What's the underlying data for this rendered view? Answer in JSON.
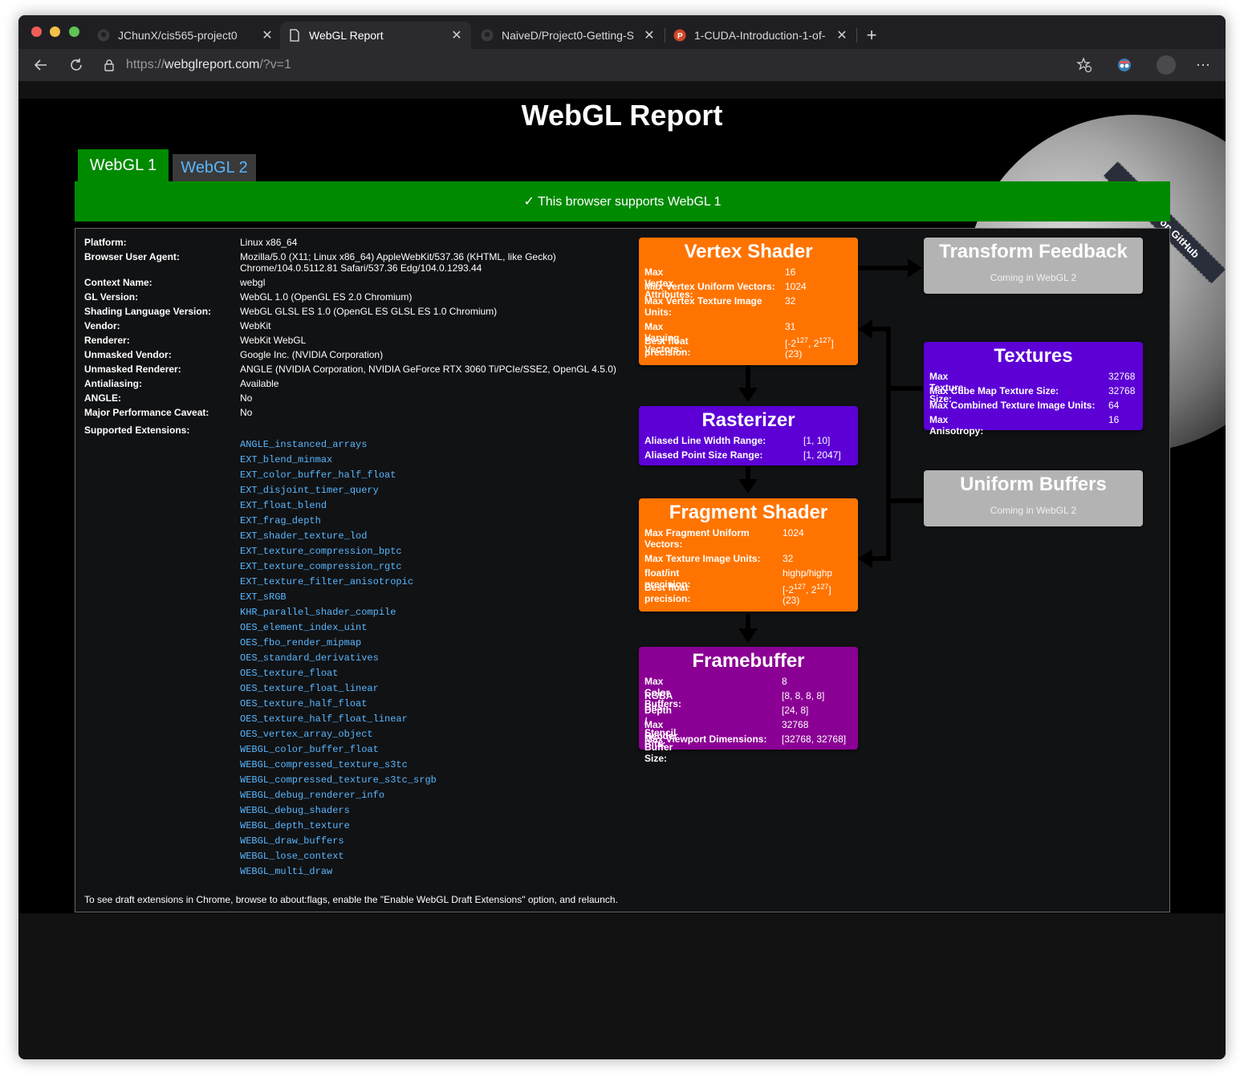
{
  "browser": {
    "tabs": [
      {
        "title": "JChunX/cis565-project0",
        "icon": "github-icon"
      },
      {
        "title": "WebGL Report",
        "icon": "page-icon"
      },
      {
        "title": "NaiveD/Project0-Getting-S",
        "icon": "github-icon"
      },
      {
        "title": "1-CUDA-Introduction-1-of-",
        "icon": "powerpoint-icon"
      }
    ],
    "new_tab": "+",
    "url_protocol": "https://",
    "url_host": "webglreport.com",
    "url_path": "/?v=1"
  },
  "page": {
    "title": "WebGL Report",
    "ribbon": "Fork me on GitHub",
    "tabs": [
      "WebGL 1",
      "WebGL 2"
    ],
    "support_message": "✓ This browser supports WebGL 1",
    "footnote": "To see draft extensions in Chrome, browse to about:flags, enable the \"Enable WebGL Draft Extensions\" option, and relaunch."
  },
  "info": [
    {
      "label": "Platform:",
      "value": "Linux x86_64"
    },
    {
      "label": "Browser User Agent:",
      "value": "Mozilla/5.0 (X11; Linux x86_64) AppleWebKit/537.36 (KHTML, like Gecko)",
      "value2": "Chrome/104.0.5112.81 Safari/537.36 Edg/104.0.1293.44"
    },
    {
      "label": "Context Name:",
      "value": "webgl"
    },
    {
      "label": "GL Version:",
      "value": "WebGL 1.0 (OpenGL ES 2.0 Chromium)"
    },
    {
      "label": "Shading Language Version:",
      "value": "WebGL GLSL ES 1.0 (OpenGL ES GLSL ES 1.0 Chromium)"
    },
    {
      "label": "Vendor:",
      "value": "WebKit"
    },
    {
      "label": "Renderer:",
      "value": "WebKit WebGL"
    },
    {
      "label": "Unmasked Vendor:",
      "value": "Google Inc. (NVIDIA Corporation)"
    },
    {
      "label": "Unmasked Renderer:",
      "value": "ANGLE (NVIDIA Corporation, NVIDIA GeForce RTX 3060 Ti/PCIe/SSE2, OpenGL 4.5.0)"
    },
    {
      "label": "Antialiasing:",
      "value": "Available"
    },
    {
      "label": "ANGLE:",
      "value": "No"
    },
    {
      "label": "Major Performance Caveat:",
      "value": "No"
    },
    {
      "label": "Supported Extensions:",
      "value": ""
    }
  ],
  "extensions": [
    "ANGLE_instanced_arrays",
    "EXT_blend_minmax",
    "EXT_color_buffer_half_float",
    "EXT_disjoint_timer_query",
    "EXT_float_blend",
    "EXT_frag_depth",
    "EXT_shader_texture_lod",
    "EXT_texture_compression_bptc",
    "EXT_texture_compression_rgtc",
    "EXT_texture_filter_anisotropic",
    "EXT_sRGB",
    "KHR_parallel_shader_compile",
    "OES_element_index_uint",
    "OES_fbo_render_mipmap",
    "OES_standard_derivatives",
    "OES_texture_float",
    "OES_texture_float_linear",
    "OES_texture_half_float",
    "OES_texture_half_float_linear",
    "OES_vertex_array_object",
    "WEBGL_color_buffer_float",
    "WEBGL_compressed_texture_s3tc",
    "WEBGL_compressed_texture_s3tc_srgb",
    "WEBGL_debug_renderer_info",
    "WEBGL_debug_shaders",
    "WEBGL_depth_texture",
    "WEBGL_draw_buffers",
    "WEBGL_lose_context",
    "WEBGL_multi_draw"
  ],
  "pipeline": {
    "vertex_shader": {
      "title": "Vertex Shader",
      "color": "#ff7400",
      "rows": [
        {
          "label": "Max Vertex Attributes:",
          "value": "16"
        },
        {
          "label": "Max Vertex Uniform Vectors:",
          "value": "1024"
        },
        {
          "label": "Max Vertex Texture Image",
          "label2": "Units:",
          "value": "32"
        },
        {
          "label": "Max Varying Vectors:",
          "value": "31"
        },
        {
          "label": "Best float precision:",
          "value": "[-2",
          "sup1": "127",
          "mid": ", 2",
          "sup2": "127",
          "end": "]",
          "value2": "(23)"
        }
      ]
    },
    "rasterizer": {
      "title": "Rasterizer",
      "color": "#5c00d6",
      "rows": [
        {
          "label": "Aliased Line Width Range:",
          "value": "[1, 10]"
        },
        {
          "label": "Aliased Point Size Range:",
          "value": "[1, 2047]"
        }
      ]
    },
    "fragment_shader": {
      "title": "Fragment Shader",
      "color": "#ff7400",
      "rows": [
        {
          "label": "Max Fragment Uniform",
          "label2": "Vectors:",
          "value": "1024"
        },
        {
          "label": "Max Texture Image Units:",
          "value": "32"
        },
        {
          "label": "float/int precision:",
          "value": "highp/highp"
        },
        {
          "label": "Best float precision:",
          "value": "[-2",
          "sup1": "127",
          "mid": ", 2",
          "sup2": "127",
          "end": "]",
          "value2": "(23)"
        }
      ]
    },
    "framebuffer": {
      "title": "Framebuffer",
      "color": "#8b0094",
      "rows": [
        {
          "label": "Max Color Buffers:",
          "value": "8"
        },
        {
          "label": "RGBA Bits:",
          "value": "[8, 8, 8, 8]"
        },
        {
          "label": "Depth / Stencil Bits:",
          "value": "[24, 8]"
        },
        {
          "label": "Max Render Buffer Size:",
          "value": "32768"
        },
        {
          "label": "Max Viewport Dimensions:",
          "value": "[32768, 32768]"
        }
      ]
    },
    "transform_feedback": {
      "title": "Transform Feedback",
      "color": "#b3b3b3",
      "note": "Coming in WebGL 2"
    },
    "textures": {
      "title": "Textures",
      "color": "#5c00d6",
      "rows": [
        {
          "label": "Max Texture Size:",
          "value": "32768"
        },
        {
          "label": "Max Cube Map Texture Size:",
          "value": "32768"
        },
        {
          "label": "Max Combined Texture Image Units:",
          "value": "64"
        },
        {
          "label": "Max Anisotropy:",
          "value": "16"
        }
      ]
    },
    "uniform_buffers": {
      "title": "Uniform Buffers",
      "color": "#b3b3b3",
      "note": "Coming in WebGL 2"
    }
  }
}
